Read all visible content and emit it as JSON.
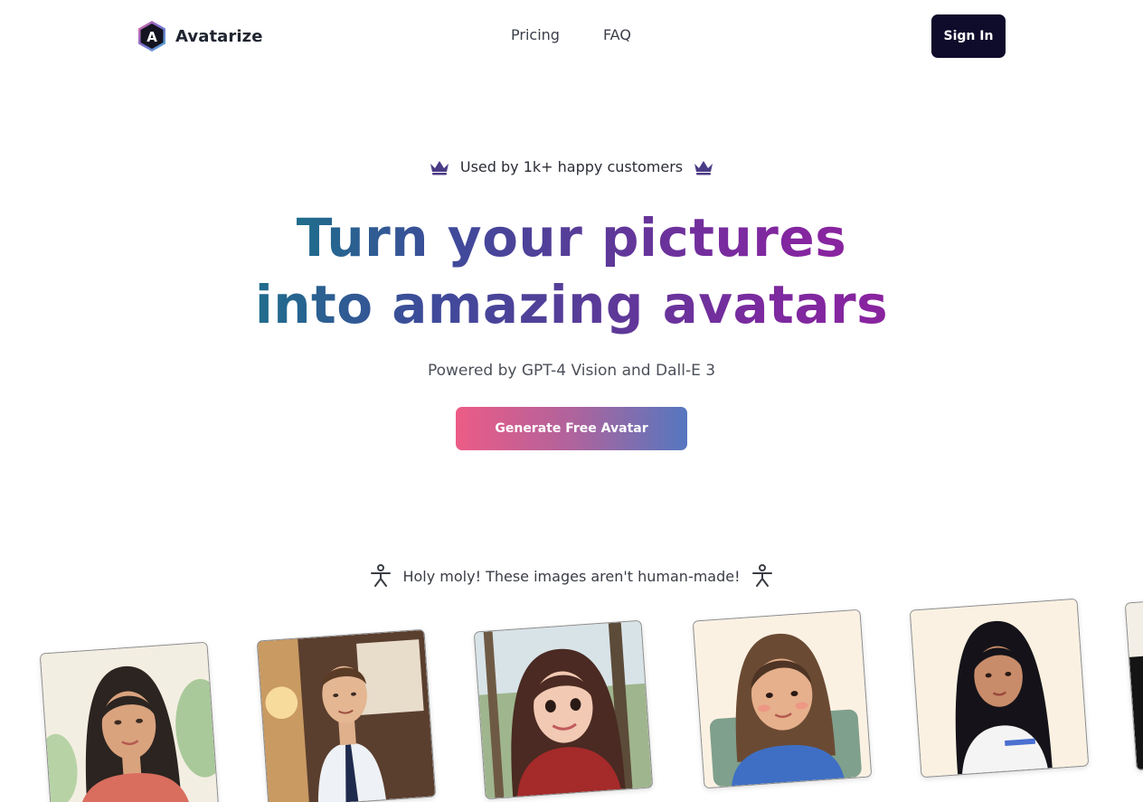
{
  "brand": {
    "name": "Avatarize",
    "logo_letter": "A"
  },
  "nav": {
    "items": [
      "Pricing",
      "FAQ"
    ]
  },
  "header": {
    "signin_label": "Sign In"
  },
  "hero": {
    "badge_text": "Used by 1k+ happy customers",
    "badge_icon": "crown-icon",
    "headline_line1": "Turn your pictures",
    "headline_line2": "into amazing avatars",
    "subtitle": "Powered by GPT-4 Vision and Dall-E 3",
    "cta_label": "Generate Free Avatar"
  },
  "gallery": {
    "caption": "Holy moly! These images aren't human-made!",
    "caption_icon": "person-icon",
    "images": [
      "avatar-woman-green-leaves",
      "avatar-man-white-shirt-tie",
      "avatar-woman-red-sweater-park",
      "avatar-woman-brown-hair",
      "avatar-woman-black-hair",
      "avatar-partial"
    ]
  },
  "colors": {
    "signin_bg": "#0f0b2a",
    "crown": "#4b3b86",
    "headline_gradient": [
      "#1f6d8c",
      "#5b3a98",
      "#8a239f"
    ],
    "cta_gradient": [
      "#ec5b86",
      "#5577c0"
    ]
  }
}
